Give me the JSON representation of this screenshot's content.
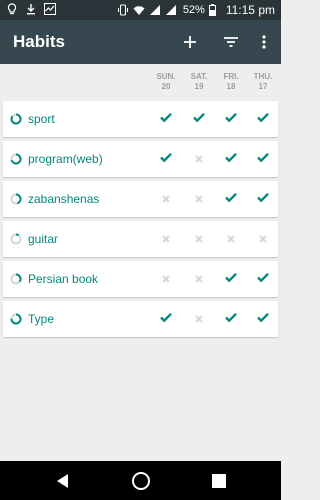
{
  "status_bar": {
    "battery": "52%",
    "time": "11:15 pm",
    "left_icons": [
      "bulb-icon",
      "download-icon",
      "activity-icon"
    ],
    "right_icons": [
      "vibrate-icon",
      "wifi-icon",
      "signal-icon",
      "signal-icon",
      "battery-icon"
    ]
  },
  "app_bar": {
    "title": "Habits",
    "actions": [
      "add-icon",
      "filter-icon",
      "overflow-menu-icon"
    ]
  },
  "days": [
    {
      "name": "SUN.",
      "num": "20"
    },
    {
      "name": "SAT.",
      "num": "19"
    },
    {
      "name": "FRI.",
      "num": "18"
    },
    {
      "name": "THU.",
      "num": "17"
    }
  ],
  "habits": [
    {
      "name": "sport",
      "score": 0.85,
      "checks": [
        true,
        true,
        true,
        true
      ]
    },
    {
      "name": "program(web)",
      "score": 0.7,
      "checks": [
        true,
        false,
        true,
        true
      ]
    },
    {
      "name": "zabanshenas",
      "score": 0.45,
      "checks": [
        false,
        false,
        true,
        true
      ]
    },
    {
      "name": "guitar",
      "score": 0.1,
      "checks": [
        false,
        false,
        false,
        false
      ]
    },
    {
      "name": "Persian book",
      "score": 0.35,
      "checks": [
        false,
        false,
        true,
        true
      ]
    },
    {
      "name": "Type",
      "score": 0.75,
      "checks": [
        true,
        false,
        true,
        true
      ]
    }
  ],
  "colors": {
    "accent": "#00897b",
    "unchecked": "#d7d7d7",
    "ring_track": "#cfd8dc",
    "app_bar": "#37474f",
    "status_bar": "#2a3338"
  },
  "nav_bar": [
    "back-icon",
    "home-icon",
    "recents-icon"
  ]
}
